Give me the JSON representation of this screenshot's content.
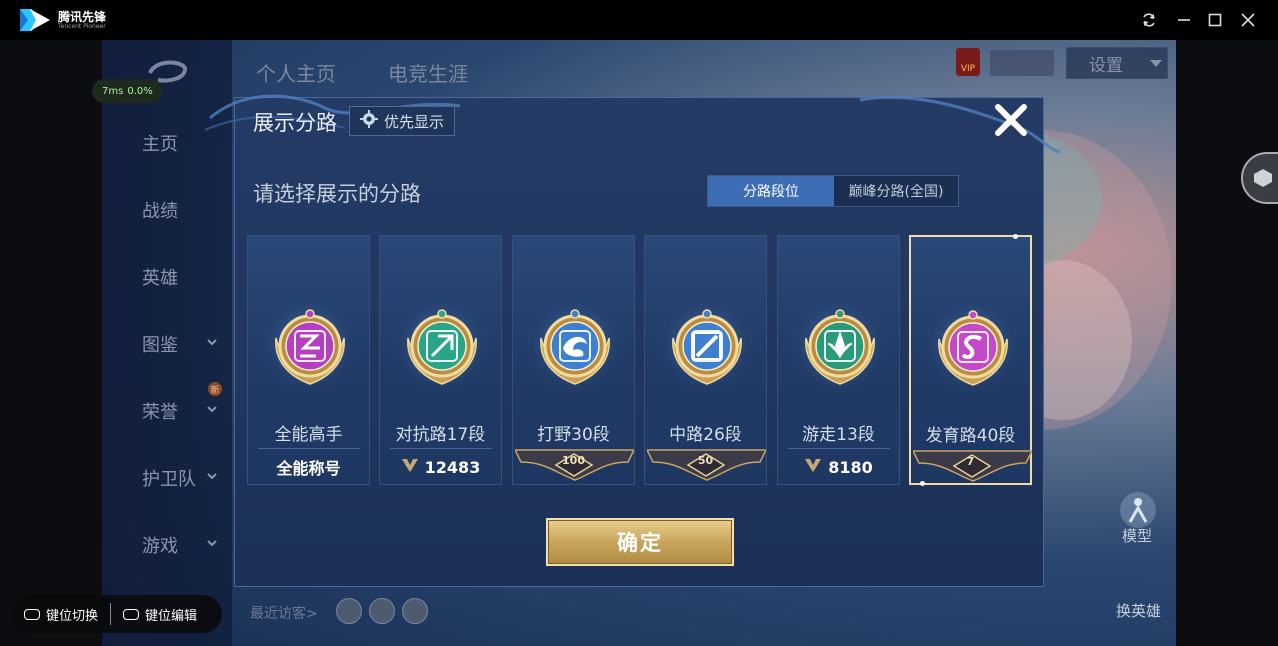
{
  "app": {
    "brand_name": "腾讯先锋",
    "brand_sub": "Tencent Pioneer",
    "perf": {
      "latency": "7ms",
      "loss": "0.0%"
    }
  },
  "window_controls": [
    "refresh-icon",
    "minimize-icon",
    "maximize-icon",
    "close-icon"
  ],
  "background": {
    "top_tabs": [
      "个人主页",
      "电竞生涯"
    ],
    "settings_label": "设置",
    "nav_items": [
      {
        "label": "主页",
        "chevron": false,
        "new": false
      },
      {
        "label": "战绩",
        "chevron": false,
        "new": false
      },
      {
        "label": "英雄",
        "chevron": false,
        "new": false
      },
      {
        "label": "图鉴",
        "chevron": true,
        "new": false
      },
      {
        "label": "荣誉",
        "chevron": true,
        "new": true
      },
      {
        "label": "护卫队",
        "chevron": true,
        "new": false
      },
      {
        "label": "游戏",
        "chevron": true,
        "new": false
      }
    ],
    "new_badge": "新",
    "recent_visitors_label": "最近访客>",
    "right_labels": {
      "model": "模型",
      "change_hero": "换英雄"
    }
  },
  "keybar": {
    "switch_label": "键位切换",
    "edit_label": "键位编辑"
  },
  "modal": {
    "title": "展示分路",
    "priority_label": "优先显示",
    "subtitle": "请选择展示的分路",
    "tabs": [
      {
        "label": "分路段位",
        "active": true
      },
      {
        "label": "巅峰分路(全国)",
        "active": false
      }
    ],
    "cards": [
      {
        "name": "全能高手",
        "footer_type": "text",
        "footer": "全能称号",
        "color": "#b43fc0",
        "selected": false
      },
      {
        "name": "对抗路17段",
        "footer_type": "score",
        "footer": "12483",
        "color": "#2aa58a",
        "selected": false
      },
      {
        "name": "打野30段",
        "footer_type": "rank",
        "footer": "100",
        "color": "#3f7fd0",
        "selected": false
      },
      {
        "name": "中路26段",
        "footer_type": "rank",
        "footer": "50",
        "color": "#3f7fd0",
        "selected": false
      },
      {
        "name": "游走13段",
        "footer_type": "score",
        "footer": "8180",
        "color": "#2a9a7a",
        "selected": false
      },
      {
        "name": "发育路40段",
        "footer_type": "rank",
        "footer": "7",
        "color": "#c548c8",
        "selected": true
      }
    ],
    "confirm_label": "确定"
  }
}
